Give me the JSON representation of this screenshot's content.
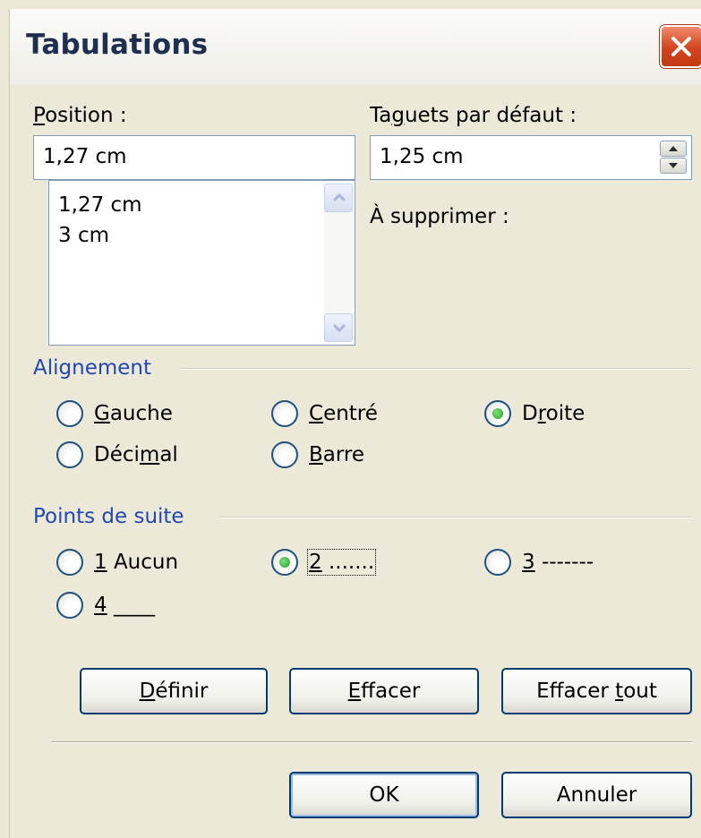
{
  "dialog": {
    "title": "Tabulations"
  },
  "position": {
    "label_prefix": "",
    "label_mnemonic": "P",
    "label_rest": "osition :",
    "value": "1,27 cm",
    "list": [
      "1,27 cm",
      "3 cm"
    ]
  },
  "default_tabs": {
    "label_prefix": "Ta",
    "label_mnemonic": "g",
    "label_rest": "uets par défaut :",
    "value": "1,25 cm"
  },
  "to_delete": {
    "label": "À supprimer :"
  },
  "alignment": {
    "group_label": "Alignement",
    "options": [
      {
        "prefix": "",
        "mnemonic": "G",
        "rest": "auche",
        "checked": false
      },
      {
        "prefix": "",
        "mnemonic": "C",
        "rest": "entré",
        "checked": false
      },
      {
        "prefix": "D",
        "mnemonic": "r",
        "rest": "oite",
        "checked": true
      },
      {
        "prefix": "Déci",
        "mnemonic": "m",
        "rest": "al",
        "checked": false
      },
      {
        "prefix": "",
        "mnemonic": "B",
        "rest": "arre",
        "checked": false
      }
    ]
  },
  "leader": {
    "group_label": "Points de suite",
    "options": [
      {
        "prefix": "",
        "mnemonic": "1",
        "rest": " Aucun",
        "checked": false
      },
      {
        "prefix": "",
        "mnemonic": "2",
        "rest": " .......",
        "checked": true
      },
      {
        "prefix": "",
        "mnemonic": "3",
        "rest": " -------",
        "checked": false
      },
      {
        "prefix": "",
        "mnemonic": "4",
        "rest": " ____",
        "checked": false
      }
    ]
  },
  "buttons": {
    "define": {
      "prefix": "",
      "mnemonic": "D",
      "rest": "éfinir"
    },
    "clear": {
      "prefix": "",
      "mnemonic": "E",
      "rest": "ffacer"
    },
    "clear_all": {
      "prefix": "Effacer ",
      "mnemonic": "t",
      "rest": "out"
    },
    "ok": "OK",
    "cancel": "Annuler"
  },
  "colors": {
    "group_label": "#2147b4",
    "close_button": "#d2441d",
    "radio_checked": "#21a121"
  }
}
